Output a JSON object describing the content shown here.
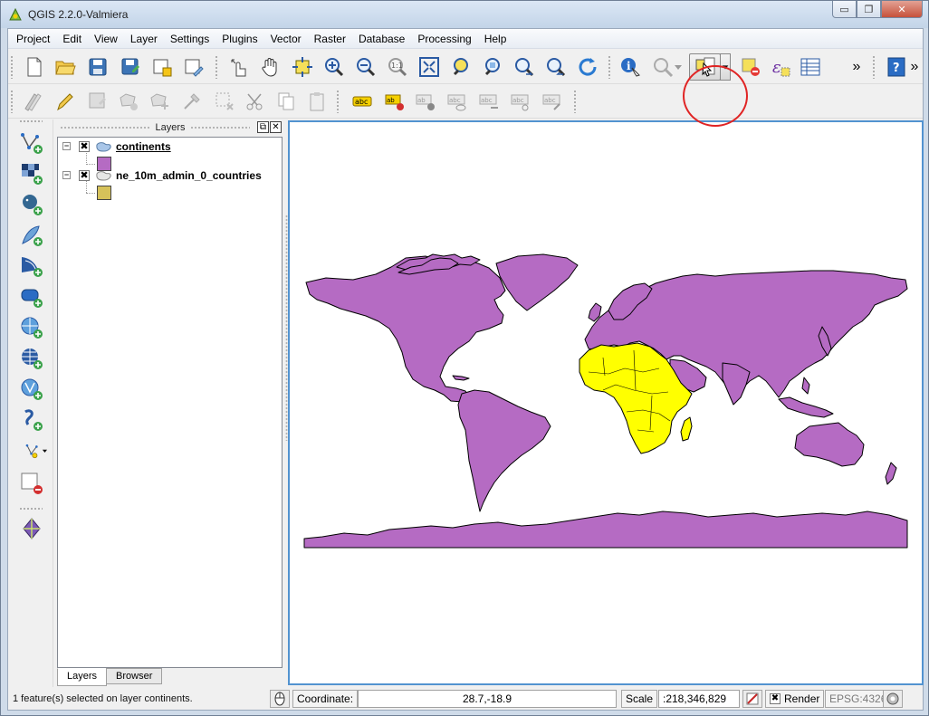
{
  "window": {
    "title": "QGIS 2.2.0-Valmiera",
    "controls": {
      "minimize": "▭",
      "maximize": "❐",
      "close": "✕"
    }
  },
  "menubar": {
    "items": [
      "Project",
      "Edit",
      "View",
      "Layer",
      "Settings",
      "Plugins",
      "Vector",
      "Raster",
      "Database",
      "Processing",
      "Help"
    ]
  },
  "toolbar_overflow": "»",
  "layers_panel": {
    "title": "Layers",
    "float_btn": "⧉",
    "close_btn": "✕",
    "layers": [
      {
        "name": "continents",
        "checked": "✖",
        "expander": "−",
        "symbol_color": "#b56bc3"
      },
      {
        "name": "ne_10m_admin_0_countries",
        "checked": "✖",
        "expander": "−",
        "symbol_color": "#d6c25a"
      }
    ],
    "tabs": [
      "Layers",
      "Browser"
    ]
  },
  "map": {
    "land_color": "#b56bc3",
    "selected_color": "#ffff00",
    "outline_color": "#000000"
  },
  "statusbar": {
    "message": "1 feature(s) selected on layer continents.",
    "coordinate_label": "Coordinate:",
    "coordinate_value": "28.7,-18.9",
    "scale_label": "Scale",
    "scale_value": ":218,346,829",
    "render_check": "✖",
    "render_label": "Render",
    "crs": "EPSG:4326"
  }
}
